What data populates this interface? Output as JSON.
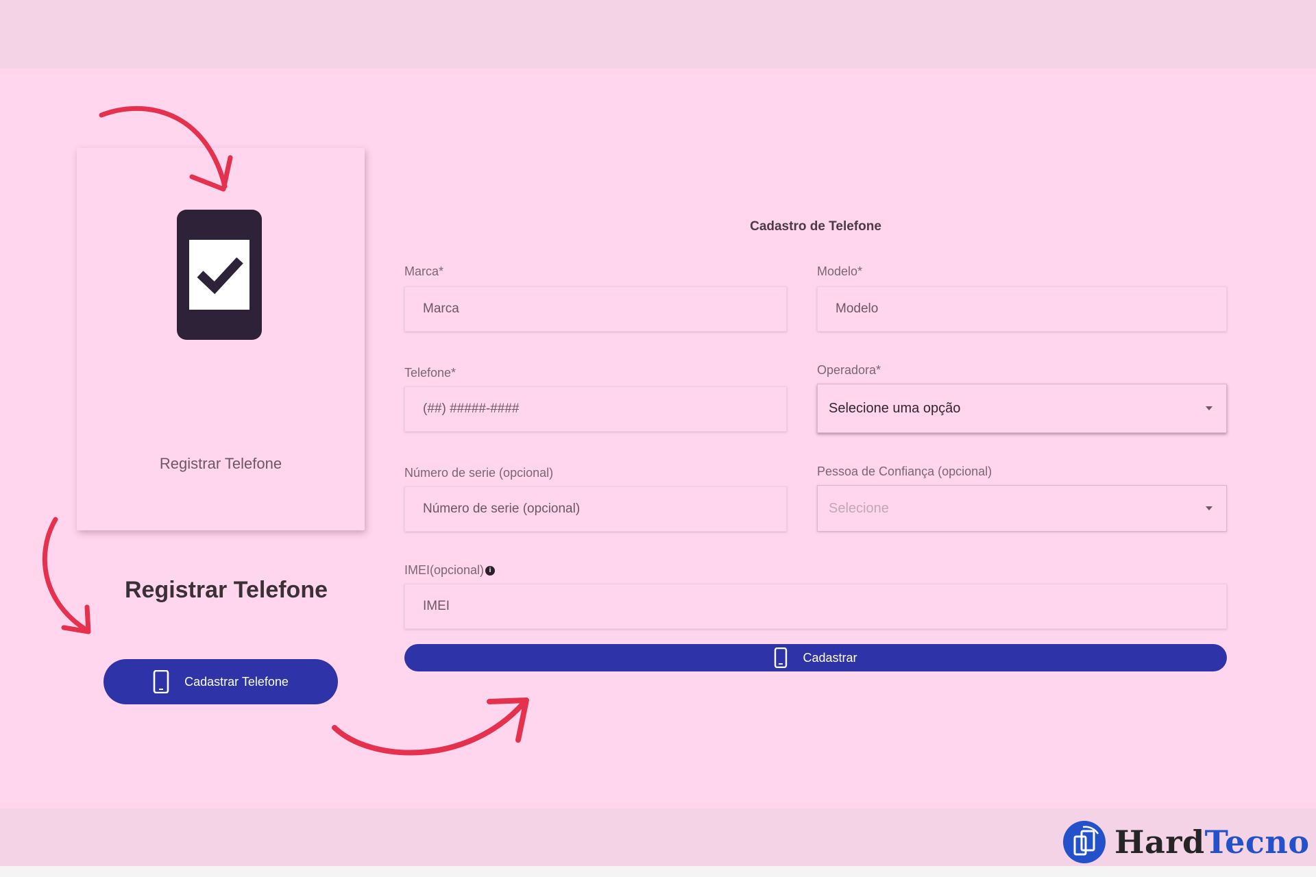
{
  "card": {
    "label": "Registrar Telefone"
  },
  "sidebar": {
    "title": "Registrar Telefone",
    "button_label": "Cadastrar Telefone"
  },
  "form": {
    "title": "Cadastro de Telefone",
    "marca": {
      "label": "Marca*",
      "placeholder": "Marca"
    },
    "modelo": {
      "label": "Modelo*",
      "placeholder": "Modelo"
    },
    "telefone": {
      "label": "Telefone*",
      "placeholder": "(##) #####-####"
    },
    "operadora": {
      "label": "Operadora*",
      "selected": "Selecione uma opção"
    },
    "numero_serie": {
      "label": "Número de serie (opcional)",
      "placeholder": "Número de serie (opcional)"
    },
    "pessoa_confianca": {
      "label": "Pessoa de Confiança (opcional)",
      "selected": "Selecione"
    },
    "imei": {
      "label": "IMEI(opcional)",
      "placeholder": "IMEI"
    },
    "submit_label": "Cadastrar"
  },
  "brand": {
    "part1": "Hard",
    "part2": "Tecno"
  },
  "colors": {
    "background": "#ffd6ee",
    "button": "#2e33a8",
    "arrow": "#e5304e",
    "brand_blue": "#2251c9"
  },
  "icons": [
    "phone-check-icon",
    "phone-icon",
    "info-icon",
    "hardtecno-logo"
  ]
}
